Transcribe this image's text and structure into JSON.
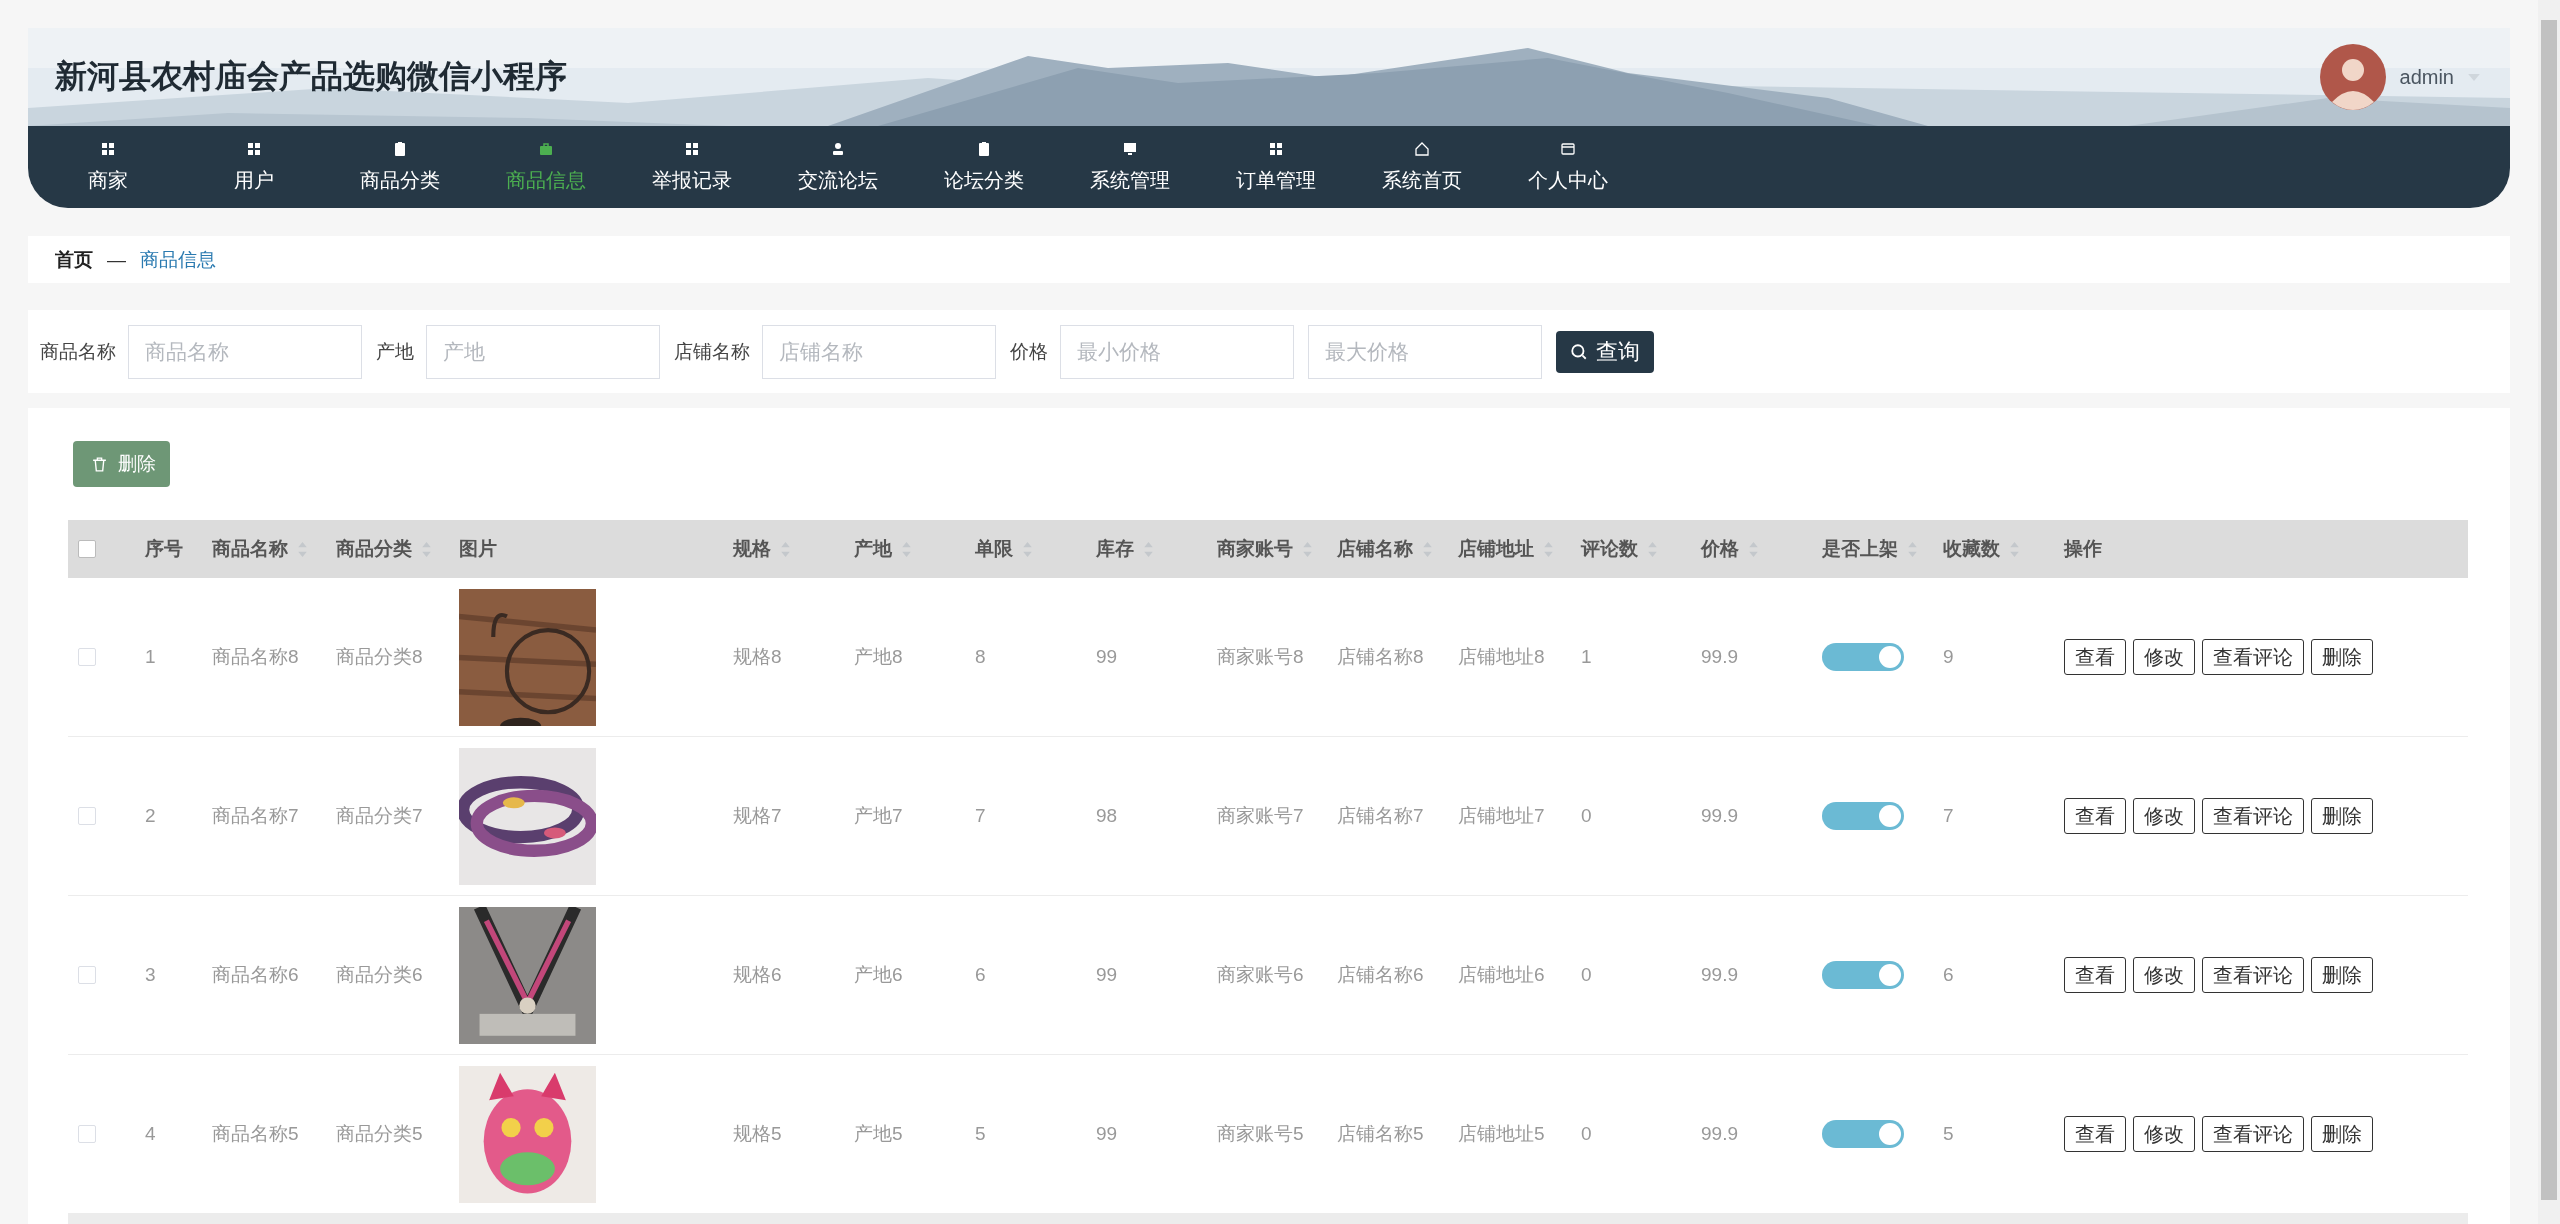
{
  "header": {
    "title": "新河县农村庙会产品选购微信小程序",
    "user": "admin"
  },
  "nav": [
    {
      "label": "商家",
      "selected": false
    },
    {
      "label": "用户",
      "selected": false
    },
    {
      "label": "商品分类",
      "selected": false
    },
    {
      "label": "商品信息",
      "selected": true
    },
    {
      "label": "举报记录",
      "selected": false
    },
    {
      "label": "交流论坛",
      "selected": false
    },
    {
      "label": "论坛分类",
      "selected": false
    },
    {
      "label": "系统管理",
      "selected": false
    },
    {
      "label": "订单管理",
      "selected": false
    },
    {
      "label": "系统首页",
      "selected": false
    },
    {
      "label": "个人中心",
      "selected": false
    }
  ],
  "breadcrumb": {
    "home": "首页",
    "separator": "—",
    "current": "商品信息"
  },
  "search": {
    "fields": [
      {
        "label": "商品名称",
        "placeholder": "商品名称"
      },
      {
        "label": "产地",
        "placeholder": "产地"
      },
      {
        "label": "店铺名称",
        "placeholder": "店铺名称"
      },
      {
        "label": "价格",
        "placeholder": "最小价格"
      },
      {
        "placeholder": "最大价格"
      }
    ],
    "button": "查询"
  },
  "delete_button": "删除",
  "table": {
    "all_checked": false,
    "columns": [
      {
        "label": "序号",
        "sortable": false
      },
      {
        "label": "商品名称",
        "sortable": true
      },
      {
        "label": "商品分类",
        "sortable": true
      },
      {
        "label": "图片",
        "sortable": false
      },
      {
        "label": "规格",
        "sortable": true
      },
      {
        "label": "产地",
        "sortable": true
      },
      {
        "label": "单限",
        "sortable": true
      },
      {
        "label": "库存",
        "sortable": true
      },
      {
        "label": "商家账号",
        "sortable": true
      },
      {
        "label": "店铺名称",
        "sortable": true
      },
      {
        "label": "店铺地址",
        "sortable": true
      },
      {
        "label": "评论数",
        "sortable": true
      },
      {
        "label": "价格",
        "sortable": true
      },
      {
        "label": "是否上架",
        "sortable": true
      },
      {
        "label": "收藏数",
        "sortable": true
      },
      {
        "label": "操作",
        "sortable": false
      }
    ],
    "rows": [
      {
        "checked": false,
        "cells": [
          "1",
          "商品名称8",
          "商品分类8",
          {
            "kind": "picture"
          },
          "规格8",
          "产地8",
          "8",
          "99",
          "商家账号8",
          "店铺名称8",
          "店铺地址8",
          "1",
          "99.9",
          {
            "kind": "switch",
            "on": true
          },
          "9",
          {
            "kind": "actions",
            "buttons": [
              "查看",
              "修改",
              "查看评论",
              "删除"
            ]
          }
        ]
      },
      {
        "checked": false,
        "cells": [
          "2",
          "商品名称7",
          "商品分类7",
          {
            "kind": "picture"
          },
          "规格7",
          "产地7",
          "7",
          "98",
          "商家账号7",
          "店铺名称7",
          "店铺地址7",
          "0",
          "99.9",
          {
            "kind": "switch",
            "on": true
          },
          "7",
          {
            "kind": "actions",
            "buttons": [
              "查看",
              "修改",
              "查看评论",
              "删除"
            ]
          }
        ]
      },
      {
        "checked": false,
        "cells": [
          "3",
          "商品名称6",
          "商品分类6",
          {
            "kind": "picture"
          },
          "规格6",
          "产地6",
          "6",
          "99",
          "商家账号6",
          "店铺名称6",
          "店铺地址6",
          "0",
          "99.9",
          {
            "kind": "switch",
            "on": true
          },
          "6",
          {
            "kind": "actions",
            "buttons": [
              "查看",
              "修改",
              "查看评论",
              "删除"
            ]
          }
        ]
      },
      {
        "checked": false,
        "cells": [
          "4",
          "商品名称5",
          "商品分类5",
          {
            "kind": "picture"
          },
          "规格5",
          "产地5",
          "5",
          "99",
          "商家账号5",
          "店铺名称5",
          "店铺地址5",
          "0",
          "99.9",
          {
            "kind": "switch",
            "on": true
          },
          "5",
          {
            "kind": "actions",
            "buttons": [
              "查看",
              "修改",
              "查看评论",
              "删除"
            ]
          }
        ]
      }
    ]
  }
}
